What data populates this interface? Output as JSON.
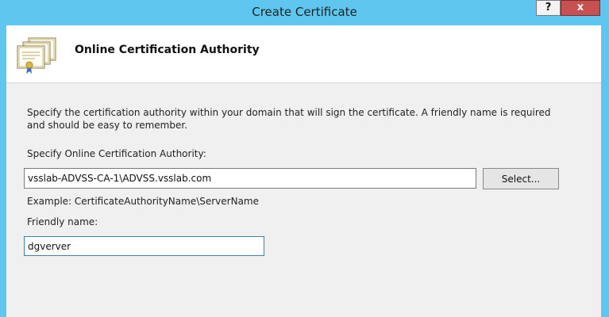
{
  "window": {
    "title": "Create Certificate",
    "help_label": "?",
    "close_label": "x"
  },
  "header": {
    "title": "Online Certification Authority",
    "icon": "certificate-icon"
  },
  "content": {
    "description": "Specify the certification authority within your domain that will sign the certificate. A friendly name is required and should be easy to remember.",
    "ca_label": "Specify Online Certification Authority:",
    "ca_value": "vsslab-ADVSS-CA-1\\ADVSS.vsslab.com",
    "select_label": "Select...",
    "example_text": "Example: CertificateAuthorityName\\ServerName",
    "friendly_label": "Friendly name:",
    "friendly_value": "dgverver"
  },
  "colors": {
    "titlebar": "#5ec6ef",
    "close_button": "#c75050",
    "client_background": "#f0f0f0"
  }
}
